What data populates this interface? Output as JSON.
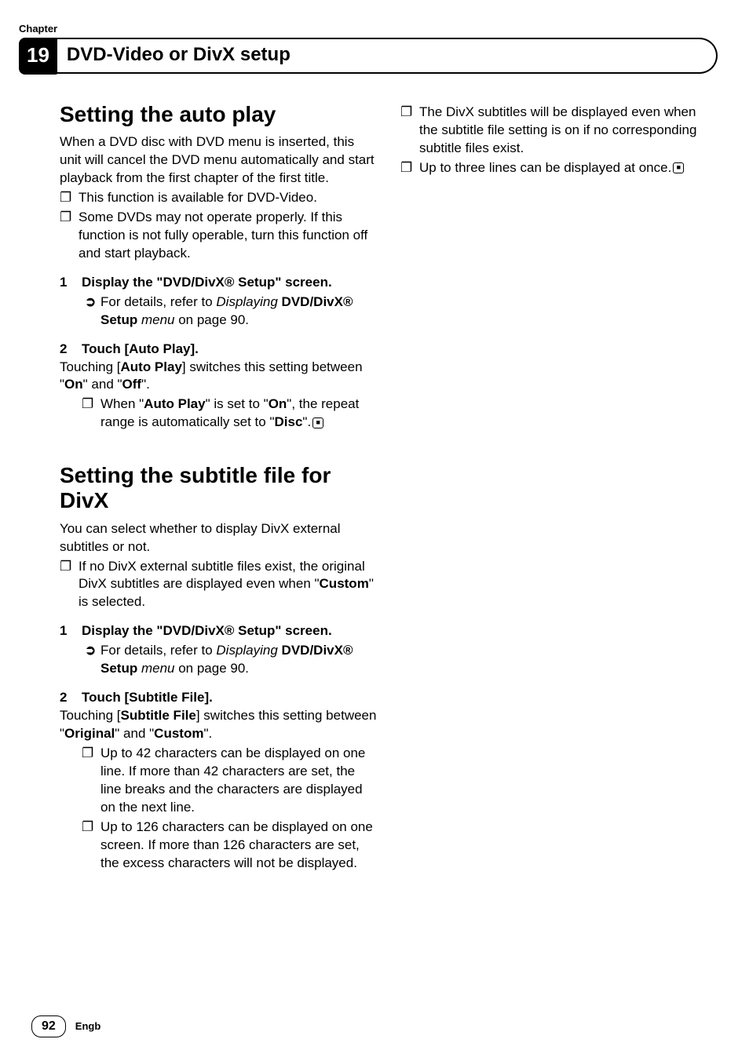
{
  "chapter": {
    "label": "Chapter",
    "number": "19",
    "title": "DVD-Video or DivX setup"
  },
  "col_left": {
    "h_autoplay": "Setting the auto play",
    "p_autoplay_intro": "When a DVD disc with DVD menu is inserted, this unit will cancel the DVD menu automatically and start playback from the first chapter of the first title.",
    "b_autoplay_1": "This function is available for DVD-Video.",
    "b_autoplay_2": "Some DVDs may not operate properly. If this function is not fully operable, turn this function off and start playback.",
    "step1_num": "1",
    "step1_text": "Display the \"DVD/DivX® Setup\" screen.",
    "ref_prefix": "For details, refer to ",
    "ref_italic": "Displaying ",
    "ref_bold": "DVD/DivX® Setup",
    "ref_italic2": " menu",
    "ref_suffix": " on page 90.",
    "step2_num": "2",
    "step2_text": "Touch [Auto Play].",
    "p_autoplay_touch_pre": "Touching [",
    "p_autoplay_touch_bold1": "Auto Play",
    "p_autoplay_touch_mid": "] switches this setting between \"",
    "p_autoplay_touch_bold2": "On",
    "p_autoplay_touch_mid2": "\" and \"",
    "p_autoplay_touch_bold3": "Off",
    "p_autoplay_touch_end": "\".",
    "note_ap_pre": "When \"",
    "note_ap_b1": "Auto Play",
    "note_ap_mid1": "\" is set to \"",
    "note_ap_b2": "On",
    "note_ap_mid2": "\", the repeat range is automatically set to \"",
    "note_ap_b3": "Disc",
    "note_ap_end": "\".",
    "h_subtitle": "Setting the subtitle file for DivX",
    "p_sub_intro": "You can select whether to display DivX external subtitles or not.",
    "b_sub_pre": "If no DivX external subtitle files exist, the original DivX subtitles are displayed even when \"",
    "b_sub_bold": "Custom",
    "b_sub_end": "\" is selected.",
    "step1b_num": "1",
    "step1b_text": "Display the \"DVD/DivX® Setup\" screen.",
    "step2b_num": "2",
    "step2b_text": "Touch [Subtitle File].",
    "p_sub_touch_pre": "Touching [",
    "p_sub_touch_b1": "Subtitle File",
    "p_sub_touch_mid1": "] switches this setting between \"",
    "p_sub_touch_b2": "Original",
    "p_sub_touch_mid2": "\" and \"",
    "p_sub_touch_b3": "Custom",
    "p_sub_touch_end": "\".",
    "note_sub_1": "Up to 42 characters can be displayed on one line. If more than 42 characters are set, the line breaks and the characters are displayed on the next line.",
    "note_sub_2": "Up to 126 characters can be displayed on one screen. If more than 126 characters are set, the excess characters will not be displayed."
  },
  "col_right": {
    "b_r1": "The DivX subtitles will be displayed even when the subtitle file setting is on if no corresponding subtitle files exist.",
    "b_r2": "Up to three lines can be displayed at once."
  },
  "glyph": {
    "square": "❐",
    "arrow": "➲",
    "endmark": "■"
  },
  "footer": {
    "page": "92",
    "lang": "Engb"
  }
}
